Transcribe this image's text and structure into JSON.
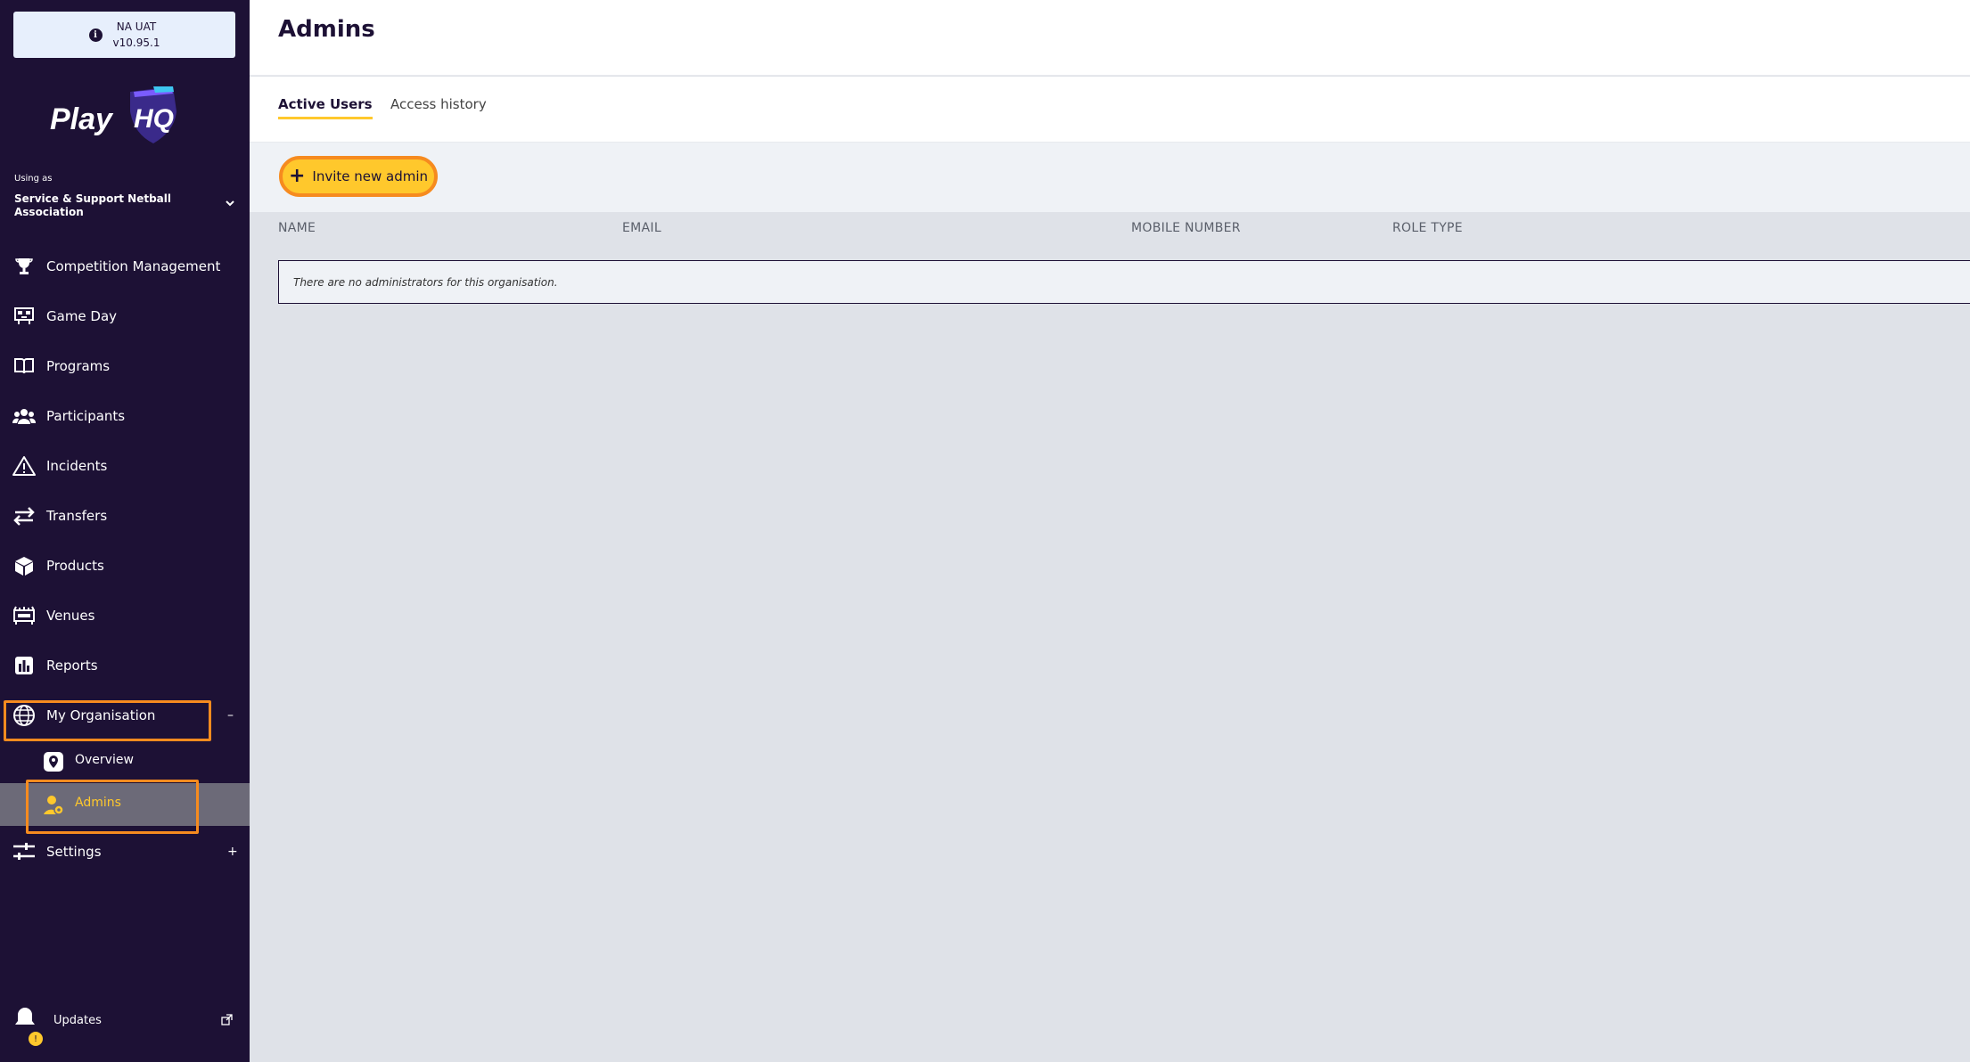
{
  "environment": {
    "name": "NA UAT",
    "version": "v10.95.1"
  },
  "brand": {
    "logo_text": "PlayHQ"
  },
  "org_switcher": {
    "using_as": "Using as",
    "org_name": "Service & Support Netball Association"
  },
  "nav": {
    "items": [
      {
        "label": "Competition Management",
        "icon": "trophy-icon"
      },
      {
        "label": "Game Day",
        "icon": "scoreboard-icon"
      },
      {
        "label": "Programs",
        "icon": "book-icon"
      },
      {
        "label": "Participants",
        "icon": "people-icon"
      },
      {
        "label": "Incidents",
        "icon": "warning-icon"
      },
      {
        "label": "Transfers",
        "icon": "transfer-arrows-icon"
      },
      {
        "label": "Products",
        "icon": "boxes-icon"
      },
      {
        "label": "Venues",
        "icon": "stadium-icon"
      },
      {
        "label": "Reports",
        "icon": "bar-chart-icon"
      },
      {
        "label": "My Organisation",
        "icon": "globe-icon",
        "toggle": "–"
      },
      {
        "label": "Settings",
        "icon": "sliders-icon",
        "toggle": "+"
      }
    ],
    "sub_items": [
      {
        "label": "Overview",
        "icon": "location-pin-icon"
      },
      {
        "label": "Admins",
        "icon": "user-gear-icon"
      }
    ],
    "updates": {
      "label": "Updates",
      "badge": "!"
    }
  },
  "page": {
    "title": "Admins"
  },
  "tabs": [
    {
      "label": "Active Users",
      "active": true
    },
    {
      "label": "Access history",
      "active": false
    }
  ],
  "toolbar": {
    "invite_label": "Invite new admin"
  },
  "table": {
    "columns": [
      "NAME",
      "EMAIL",
      "MOBILE NUMBER",
      "ROLE TYPE"
    ],
    "empty_message": "There are no administrators for this organisation."
  },
  "colors": {
    "sidebar_bg": "#1d1135",
    "accent": "#ffc82c",
    "highlight": "#f68b1f",
    "content_bg": "#dfe2e8"
  }
}
